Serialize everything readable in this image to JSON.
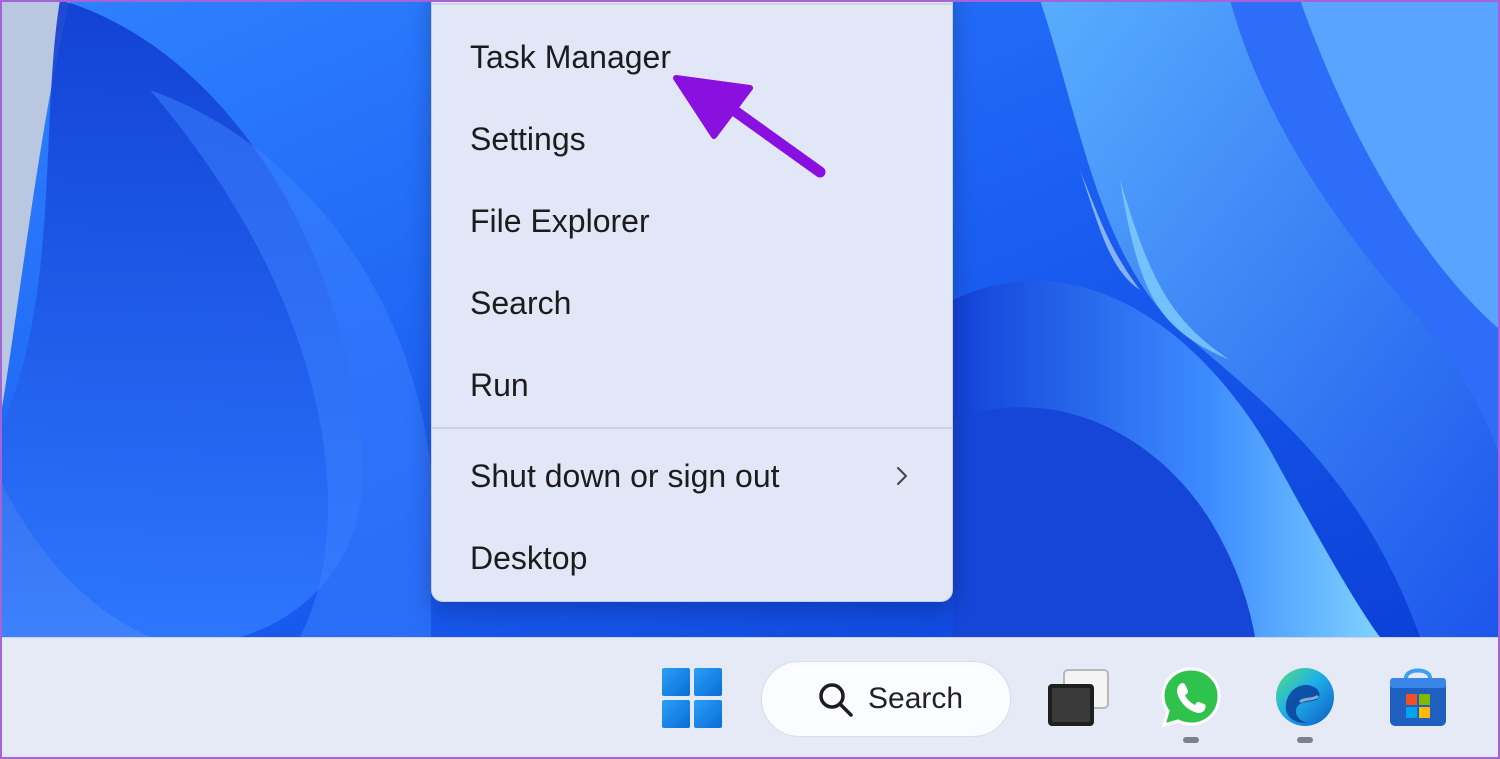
{
  "context_menu": {
    "items": [
      {
        "label": "Task Manager"
      },
      {
        "label": "Settings"
      },
      {
        "label": "File Explorer"
      },
      {
        "label": "Search"
      },
      {
        "label": "Run"
      },
      {
        "label": "Shut down or sign out",
        "has_submenu": true
      },
      {
        "label": "Desktop"
      }
    ]
  },
  "annotation": {
    "arrow_color": "#8a10e0",
    "points_to": "Task Manager"
  },
  "taskbar": {
    "search_label": "Search",
    "apps": [
      {
        "name": "start",
        "icon": "windows-logo-icon"
      },
      {
        "name": "search",
        "icon": "search-icon"
      },
      {
        "name": "task-view",
        "icon": "task-view-icon"
      },
      {
        "name": "whatsapp",
        "icon": "whatsapp-icon",
        "running": true
      },
      {
        "name": "edge",
        "icon": "edge-icon",
        "running": true
      },
      {
        "name": "store",
        "icon": "store-icon"
      }
    ]
  },
  "colors": {
    "accent": "#0a6cd8",
    "wallpaper_base": "#1a5cf0",
    "menu_background": "#e2e7f8",
    "taskbar_background": "#e6eaf6",
    "whatsapp_green": "#2fc24d"
  }
}
